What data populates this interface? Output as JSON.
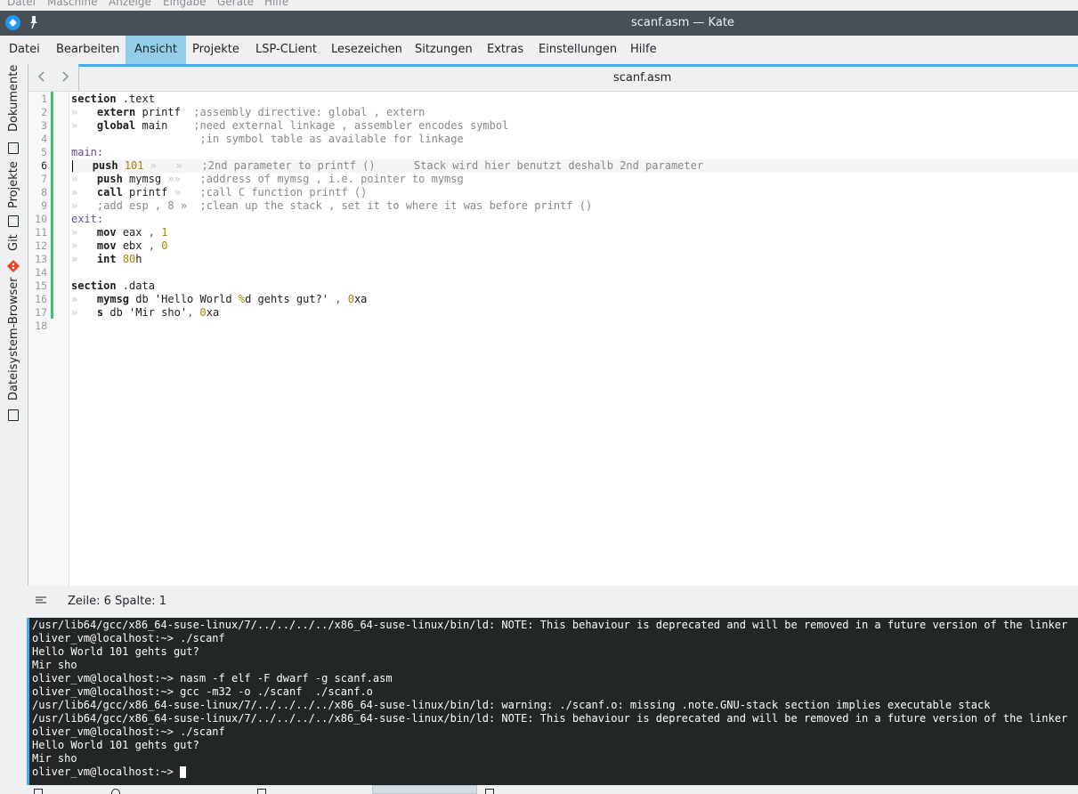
{
  "vm_menu": [
    "Datei",
    "Maschine",
    "Anzeige",
    "Eingabe",
    "Geräte",
    "Hilfe"
  ],
  "window": {
    "title": "scanf.asm — Kate"
  },
  "menubar": {
    "items": [
      "Datei",
      "Bearbeiten",
      "Ansicht",
      "Projekte",
      "LSP-CLient",
      "Lesezeichen",
      "Sitzungen",
      "Extras",
      "Einstellungen",
      "Hilfe"
    ],
    "active": "Ansicht"
  },
  "sidebar": {
    "tabs": [
      "Dokumente",
      "Projekte",
      "Git",
      "Dateisystem-Browser"
    ]
  },
  "editor": {
    "tab_label": "scanf.asm",
    "current_line": 6,
    "line_numbers": [
      "1",
      "2",
      "3",
      "4",
      "5",
      "6",
      "7",
      "8",
      "9",
      "10",
      "11",
      "12",
      "13",
      "14",
      "15",
      "16",
      "17",
      "18"
    ]
  },
  "status": {
    "cursor": "Zeile: 6 Spalte: 1"
  },
  "terminal": {
    "lines": [
      "/usr/lib64/gcc/x86_64-suse-linux/7/../../../../x86_64-suse-linux/bin/ld: NOTE: This behaviour is deprecated and will be removed in a future version of the linker",
      "oliver_vm@localhost:~> ./scanf",
      "Hello World 101 gehts gut?",
      "Mir sho",
      "oliver_vm@localhost:~> nasm -f elf -F dwarf -g scanf.asm",
      "oliver_vm@localhost:~> gcc -m32 -o ./scanf  ./scanf.o",
      "/usr/lib64/gcc/x86_64-suse-linux/7/../../../../x86_64-suse-linux/bin/ld: warning: ./scanf.o: missing .note.GNU-stack section implies executable stack",
      "/usr/lib64/gcc/x86_64-suse-linux/7/../../../../x86_64-suse-linux/bin/ld: NOTE: This behaviour is deprecated and will be removed in a future version of the linker",
      "oliver_vm@localhost:~> ./scanf",
      "Hello World 101 gehts gut?",
      "Mir sho",
      "oliver_vm@localhost:~> "
    ]
  },
  "colors": {
    "accent": "#3daee9",
    "active_menu": "#93cee9",
    "titlebar": "#475057",
    "terminal_bg": "#232627",
    "modified_marker": "#2ecc71",
    "git_icon": "#e84a2a"
  },
  "icons": {
    "app": "kate-icon",
    "pin": "pin-icon",
    "back": "chevron-left-icon",
    "forward": "chevron-right-icon",
    "status": "menu-lines-icon"
  }
}
